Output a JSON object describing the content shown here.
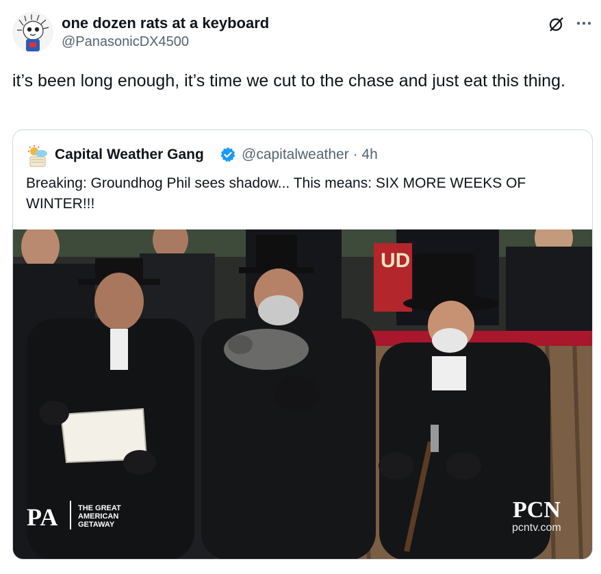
{
  "author": {
    "display_name": "one dozen rats at a keyboard",
    "handle": "@PanasonicDX4500",
    "avatar_icon": "rat-mascot-avatar"
  },
  "actions": {
    "grok_icon": "grok-icon",
    "more_icon": "more-icon"
  },
  "tweet": {
    "text": "it’s been long enough, it’s time we cut to the chase and just eat this thing."
  },
  "quote": {
    "name": "Capital Weather Gang",
    "handle_time": "@capitalweather · 4h",
    "verified_color": "#1d9bf0",
    "text": "Breaking: Groundhog Phil sees shadow...  This means: SIX MORE WEEKS OF WINTER!!!",
    "media": {
      "logo_pa": "PA",
      "logo_getaway": [
        "THE GREAT",
        "AMERICAN",
        "GETAWAY"
      ],
      "logo_pcn": "PCN",
      "logo_pcn_url": "pcntv.com",
      "sign_text": "UD"
    }
  }
}
